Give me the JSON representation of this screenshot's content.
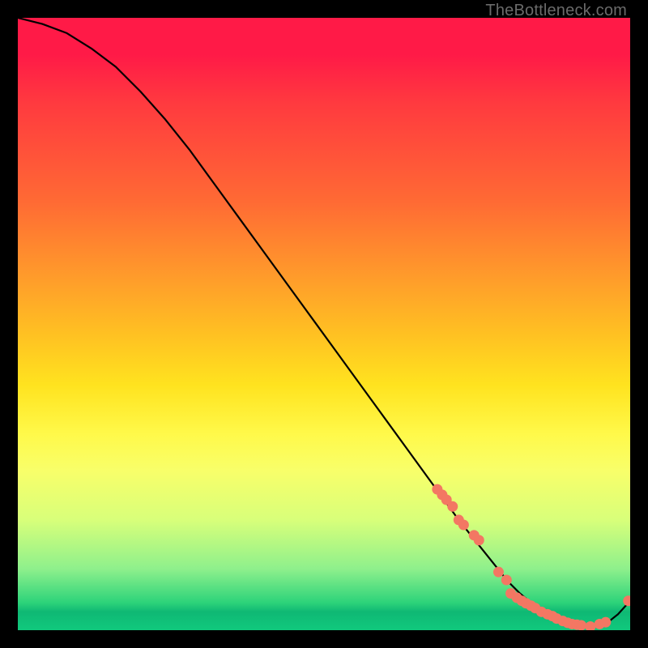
{
  "watermark": "TheBottleneck.com",
  "chart_data": {
    "type": "line",
    "title": "",
    "xlabel": "",
    "ylabel": "",
    "xlim": [
      0,
      100
    ],
    "ylim": [
      0,
      100
    ],
    "series": [
      {
        "name": "bottleneck-curve",
        "x": [
          0,
          4,
          8,
          12,
          16,
          20,
          24,
          28,
          32,
          36,
          40,
          44,
          48,
          52,
          56,
          60,
          64,
          68,
          72,
          74,
          76,
          78,
          80,
          82,
          84,
          86,
          88,
          90,
          92,
          94,
          96,
          98,
          100
        ],
        "y": [
          100,
          99,
          97.5,
          95,
          92,
          88,
          83.5,
          78.5,
          73,
          67.5,
          62,
          56.5,
          51,
          45.5,
          40,
          34.5,
          29,
          23.5,
          18,
          15.5,
          13,
          10.5,
          8,
          6,
          4.3,
          3,
          1.9,
          1.2,
          0.8,
          0.6,
          1.0,
          2.6,
          4.8
        ]
      }
    ],
    "markers": {
      "name": "highlighted-points",
      "color": "#f37763",
      "x": [
        68.5,
        69.3,
        70.0,
        71.0,
        72.0,
        72.8,
        74.5,
        75.3,
        78.5,
        79.8,
        80.5,
        81.5,
        82.3,
        83.0,
        83.8,
        84.5,
        85.5,
        86.5,
        87.3,
        88.0,
        89.0,
        89.8,
        90.5,
        91.3,
        92.0,
        93.5,
        95.0,
        96.0,
        99.7
      ],
      "y": [
        23.0,
        22.1,
        21.3,
        20.2,
        18.0,
        17.2,
        15.5,
        14.7,
        9.5,
        8.2,
        6.0,
        5.3,
        4.8,
        4.4,
        4.0,
        3.6,
        3.0,
        2.6,
        2.3,
        1.9,
        1.5,
        1.2,
        1.0,
        0.9,
        0.8,
        0.6,
        1.0,
        1.3,
        4.8
      ]
    }
  }
}
